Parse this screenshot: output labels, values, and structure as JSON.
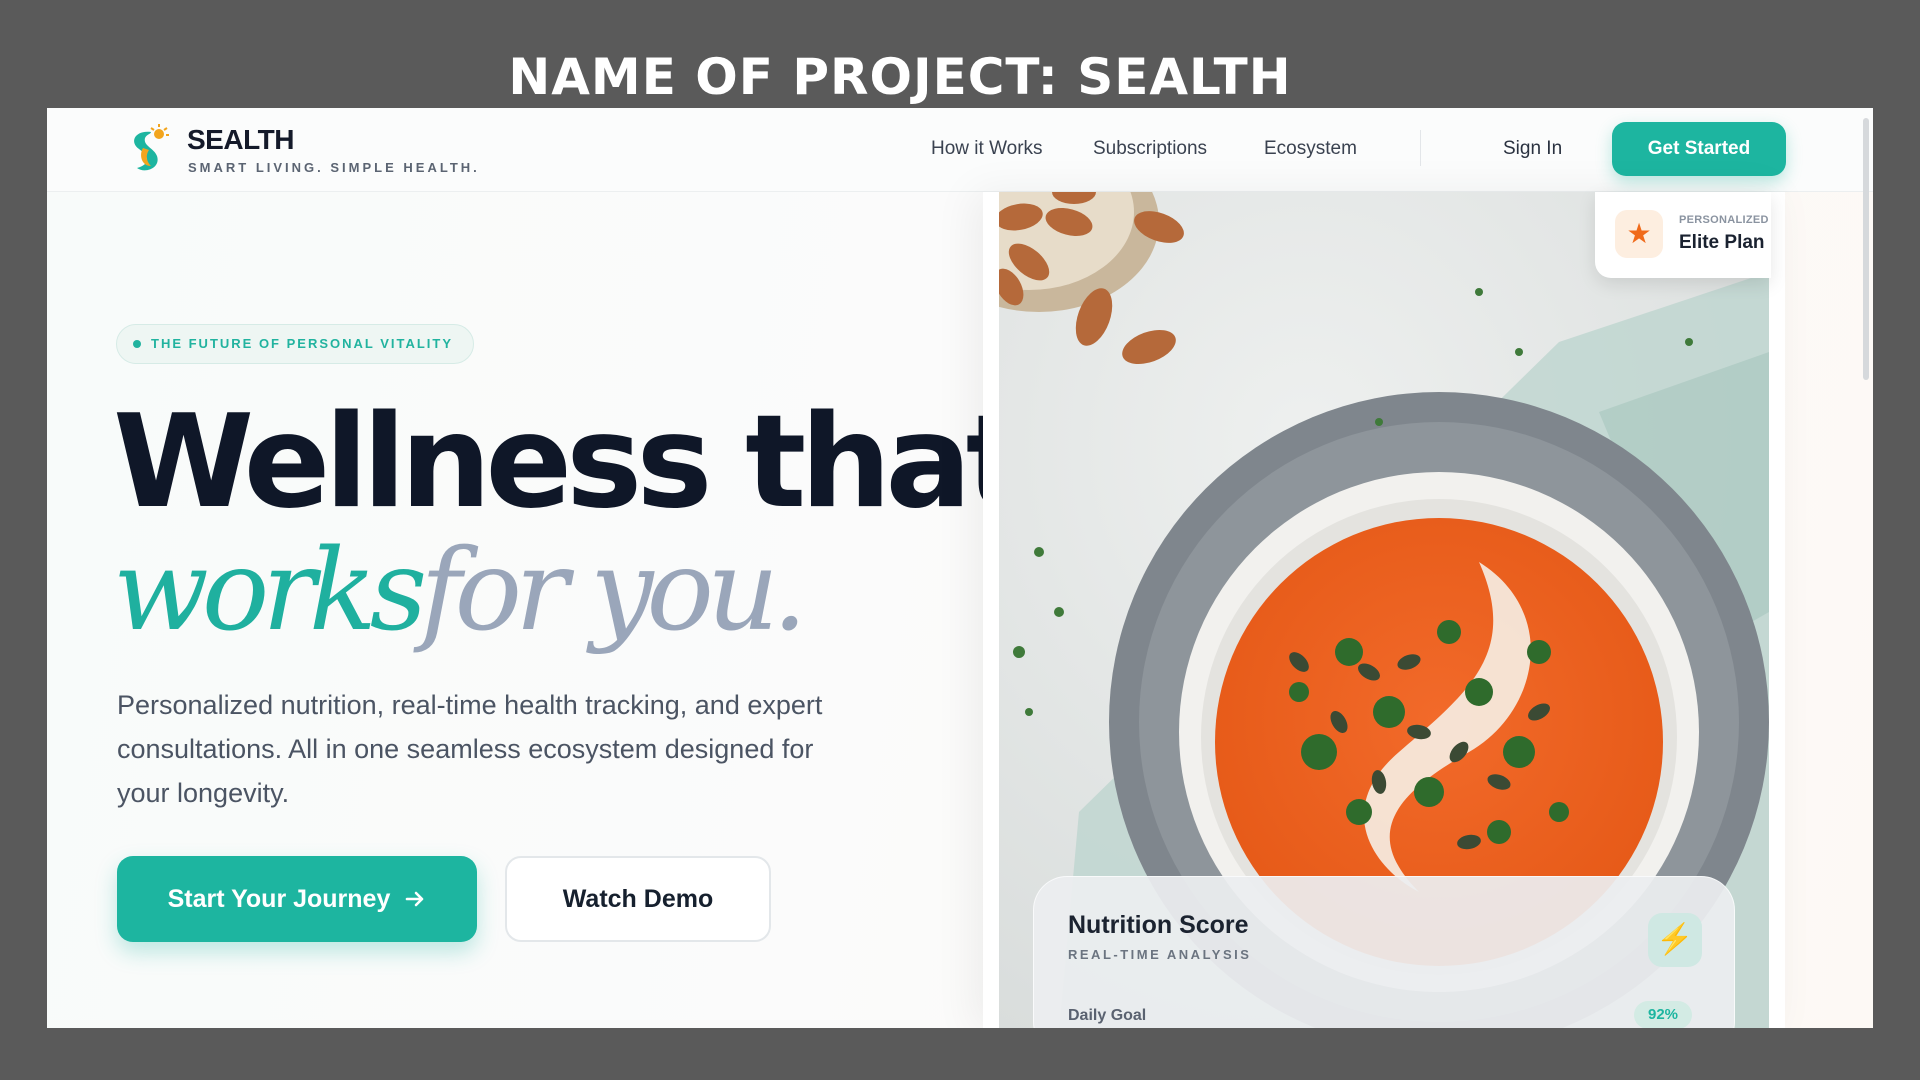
{
  "project_title": "NAME OF PROJECT: SEALTH",
  "brand": {
    "name": "SEALTH",
    "tagline": "SMART LIVING. SIMPLE HEALTH.",
    "colors": {
      "accent": "#1db5a0",
      "dark": "#0f1728",
      "muted": "#9aa6ba",
      "orange": "#f06a1a"
    }
  },
  "nav": {
    "items": [
      {
        "label": "How it Works"
      },
      {
        "label": "Subscriptions"
      },
      {
        "label": "Ecosystem"
      }
    ],
    "sign_in": "Sign In",
    "get_started": "Get Started"
  },
  "hero": {
    "pill": "THE FUTURE OF PERSONAL VITALITY",
    "headline_line1": "Wellness that",
    "headline_accent": "works",
    "headline_rest": "for you.",
    "subtext": "Personalized nutrition, real-time health tracking, and expert consultations. All in one seamless ecosystem designed for your longevity.",
    "primary_button": "Start Your Journey",
    "primary_icon": "arrow-right-icon",
    "secondary_button": "Watch Demo"
  },
  "elite_card": {
    "label": "PERSONALIZED",
    "value": "Elite Plan",
    "icon": "star-icon"
  },
  "nutrition_card": {
    "title": "Nutrition Score",
    "subtitle": "REAL-TIME ANALYSIS",
    "icon": "lightning-icon",
    "daily_label": "Daily Goal",
    "daily_value": "92%"
  }
}
